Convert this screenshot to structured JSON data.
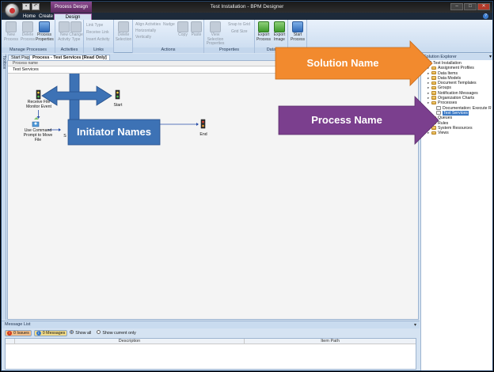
{
  "window": {
    "title": "Test Installation - BPM Designer",
    "contextual_tab_title": "Process Design",
    "help": "?"
  },
  "ribbon_tabs": [
    "Home",
    "Create",
    "Design"
  ],
  "ribbon": {
    "groups": [
      {
        "label": "Manage Processes",
        "buttons": [
          "New Process",
          "Delete Process",
          "Process Properties"
        ]
      },
      {
        "label": "Activities",
        "buttons": [
          "New Activity",
          "Change Type"
        ]
      },
      {
        "label": "Links",
        "items": [
          "Link Type",
          "Receive Link",
          "Insert Activity"
        ]
      },
      {
        "label": "",
        "buttons": [
          "Delete Selection"
        ]
      },
      {
        "label": "Actions",
        "items": [
          "Align Activities",
          "Horizontally",
          "Vertically",
          "Nudge"
        ],
        "buttons": [
          "Copy",
          "Paste"
        ]
      },
      {
        "label": "Properties",
        "buttons": [
          "View Selection Properties"
        ],
        "items": [
          "Snap to Grid",
          "Grid Size"
        ]
      },
      {
        "label": "Data",
        "buttons": [
          "Export Process",
          "Export Image"
        ]
      },
      {
        "label": "Test",
        "buttons": [
          "Start Process"
        ]
      }
    ]
  },
  "left_strip_label": "Toolbox",
  "doc_tabs": [
    "Start Page",
    "Process - Test Services [Read Only]"
  ],
  "process": {
    "header": "Process name",
    "name": "Test Services"
  },
  "diagram": {
    "nodes": [
      {
        "label": "Receive File Monitor Event"
      },
      {
        "label": "Start"
      },
      {
        "label": "Use Command Prompt to Move File"
      },
      {
        "label": "S"
      },
      {
        "label": "End"
      }
    ]
  },
  "annotations": {
    "solution_name": "Solution Name",
    "process_name": "Process Name",
    "initiator_names": "Initiator Names",
    "colors": {
      "orange": "#f28a2e",
      "purple": "#7b3f8e",
      "blue": "#3d72b5"
    }
  },
  "message_list": {
    "title": "Message List",
    "issues": "0 Issues",
    "messages": "0 Messages",
    "show_all": "Show all",
    "show_current": "Show current only",
    "columns": [
      "Description",
      "Item Path"
    ]
  },
  "solution_explorer": {
    "title": "Solution Explorer",
    "tree": [
      {
        "label": "Test Installation",
        "level": 0,
        "icon": "solution"
      },
      {
        "label": "Assignment Profiles",
        "level": 1,
        "icon": "folder"
      },
      {
        "label": "Data Items",
        "level": 1,
        "icon": "folder"
      },
      {
        "label": "Data Models",
        "level": 1,
        "icon": "folder"
      },
      {
        "label": "Document Templates",
        "level": 1,
        "icon": "folder"
      },
      {
        "label": "Groups",
        "level": 1,
        "icon": "folder"
      },
      {
        "label": "Notification Messages",
        "level": 1,
        "icon": "folder"
      },
      {
        "label": "Organization Charts",
        "level": 1,
        "icon": "folder"
      },
      {
        "label": "Processes",
        "level": 1,
        "icon": "folder"
      },
      {
        "label": "Documentation: Execute R",
        "level": 2,
        "icon": "doc"
      },
      {
        "label": "Test Services",
        "level": 2,
        "icon": "doc",
        "selected": true
      },
      {
        "label": "Queues",
        "level": 1,
        "icon": "folder"
      },
      {
        "label": "Rules",
        "level": 1,
        "icon": "folder"
      },
      {
        "label": "System Resources",
        "level": 1,
        "icon": "folder"
      },
      {
        "label": "Views",
        "level": 1,
        "icon": "folder"
      }
    ]
  }
}
